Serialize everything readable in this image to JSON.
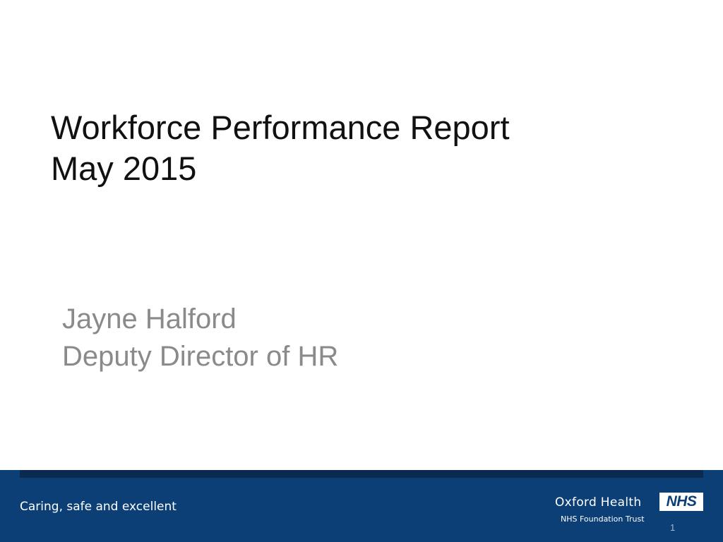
{
  "slide": {
    "title_lines": [
      "Workforce Performance Report",
      "May 2015"
    ],
    "subtitle_lines": [
      "Jayne Halford",
      "Deputy Director of HR"
    ]
  },
  "footer": {
    "tagline": "Caring, safe and excellent",
    "organisation": "Oxford Health",
    "organisation_sub": "NHS Foundation Trust",
    "badge": "NHS",
    "page_number": "1"
  },
  "colors": {
    "footer_background": "#0d3f77",
    "footer_strip": "#0a2a52",
    "title_text": "#111111",
    "subtitle_text": "#8a8a8a"
  }
}
